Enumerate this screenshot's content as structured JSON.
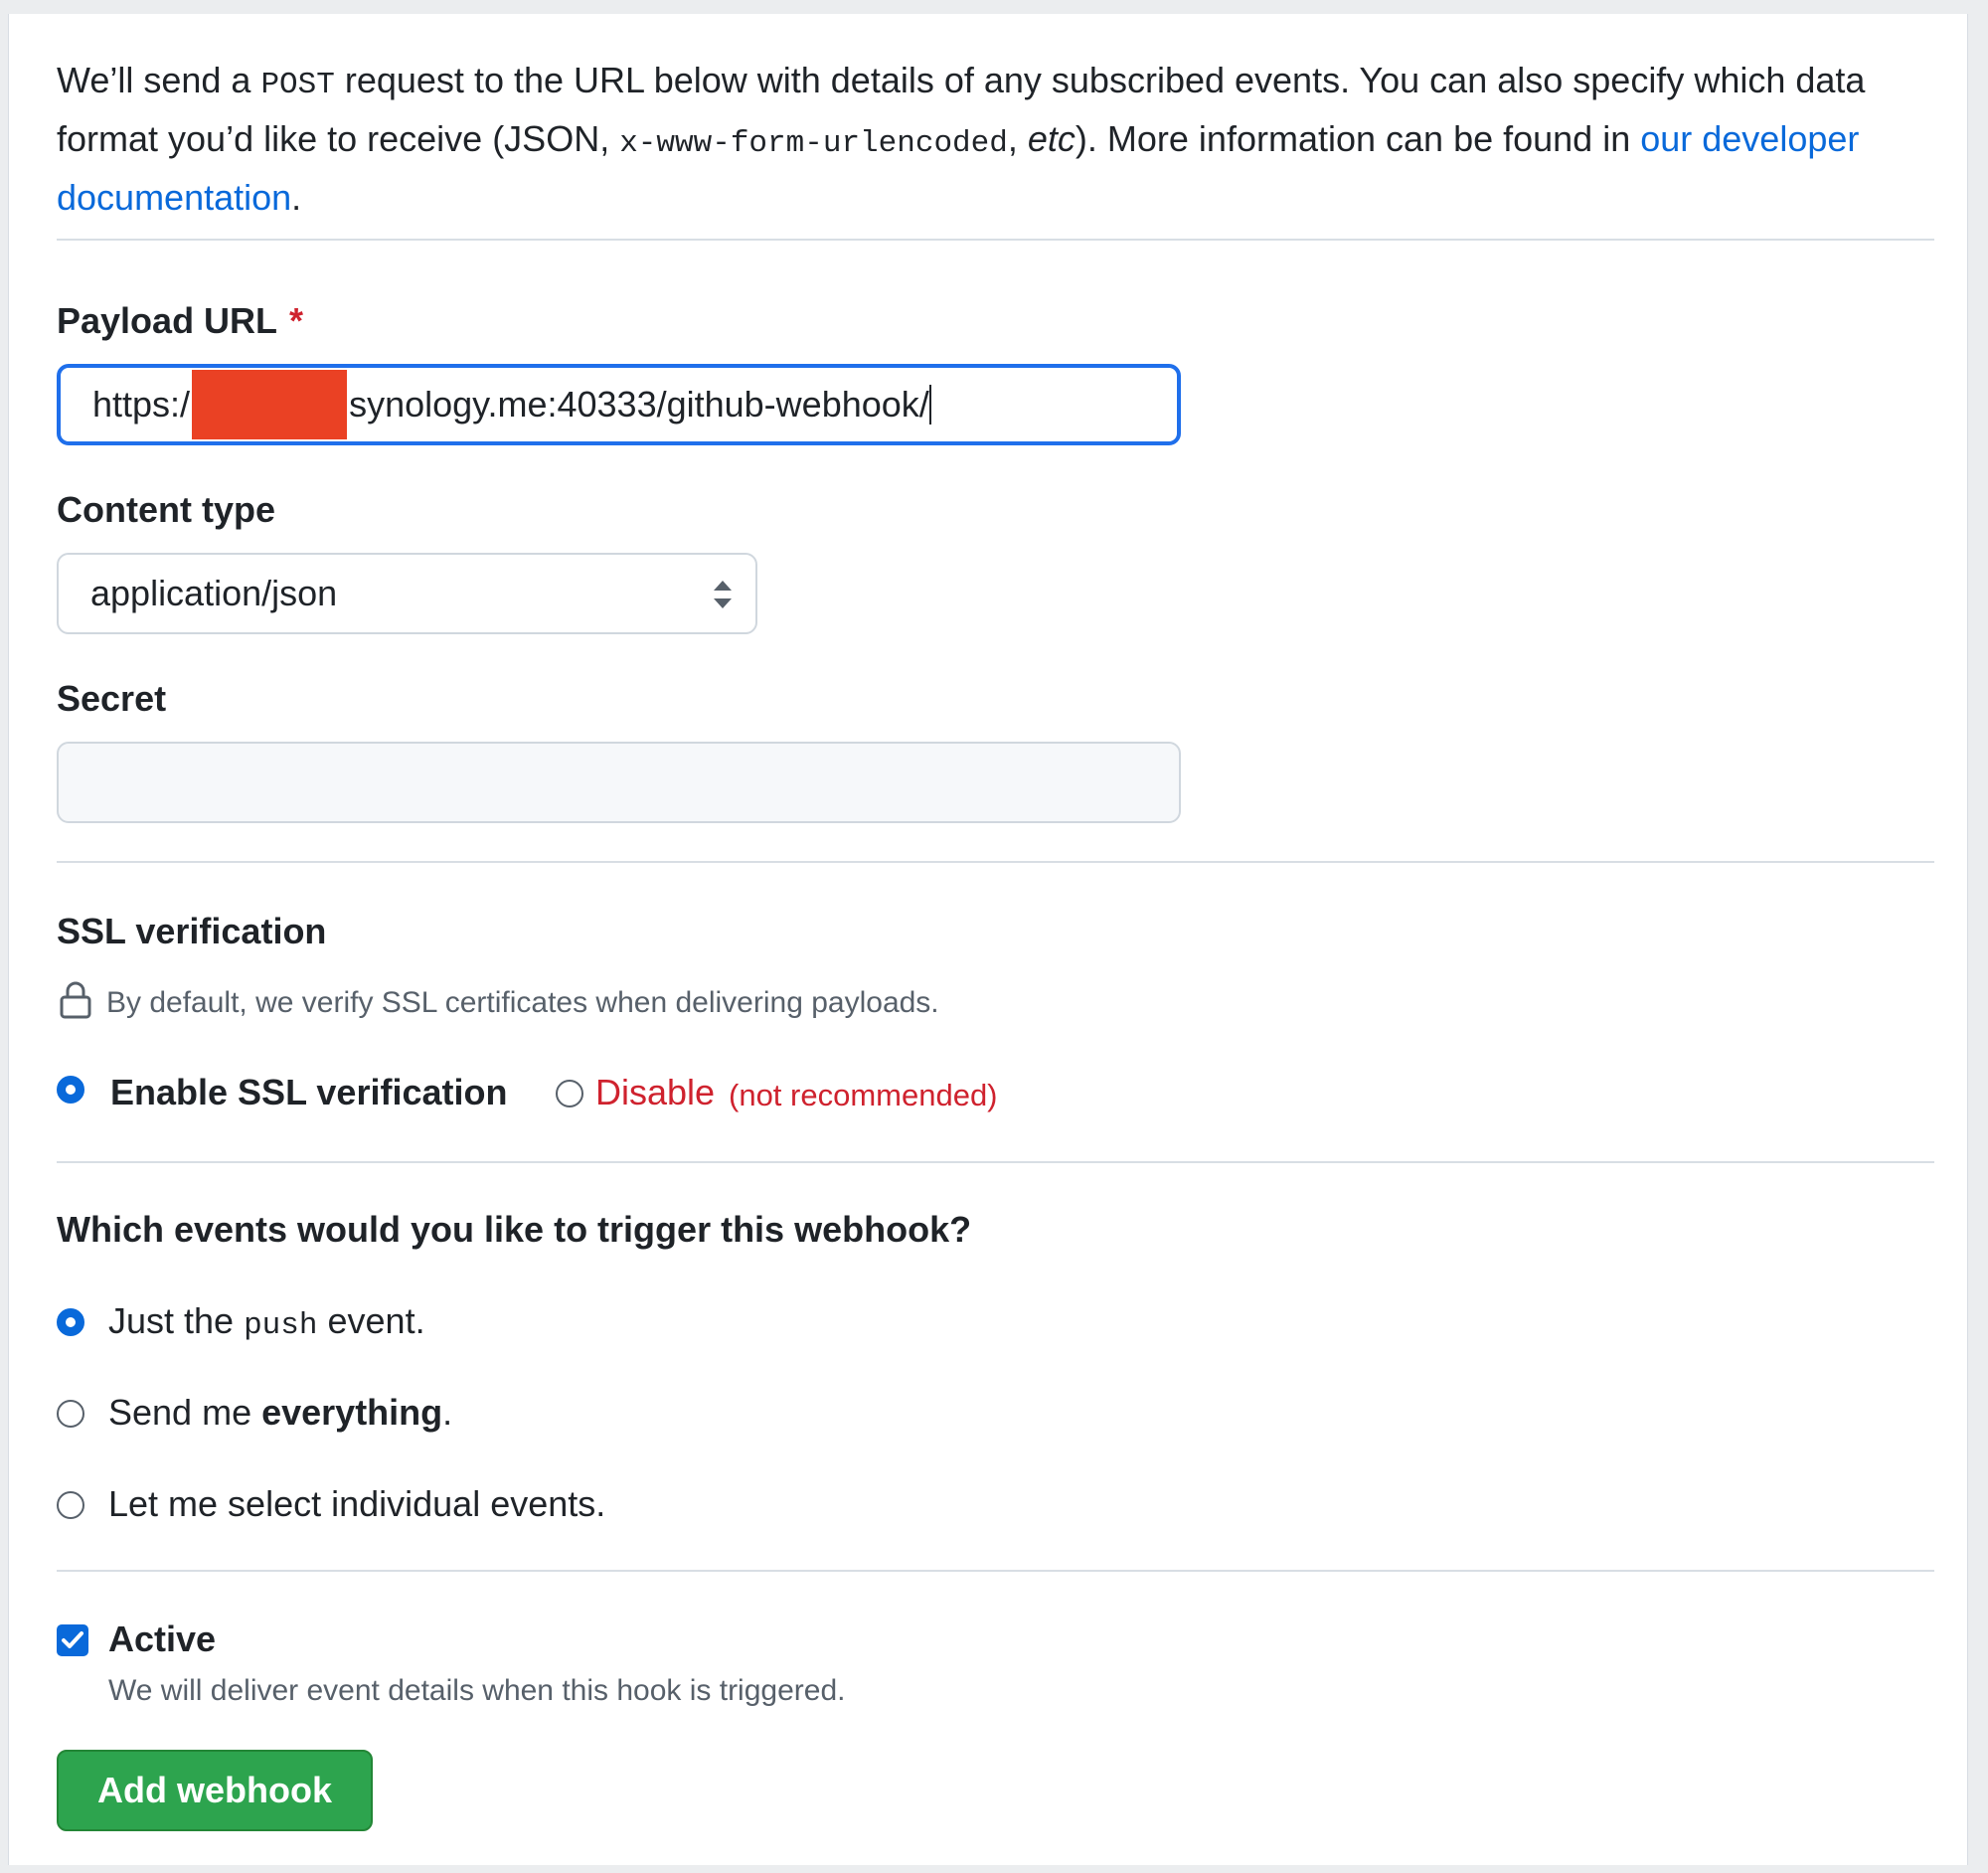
{
  "intro": {
    "p1": "We’ll send a ",
    "post_code": "POST",
    "p2": " request to the URL below with details of any subscribed events. You can also specify which data format you’d like to receive (JSON, ",
    "format_code": "x-www-form-urlencoded",
    "p3": ", ",
    "etc": "etc",
    "p4": "). More information can be found in ",
    "link_text": "our developer documentation",
    "p5": "."
  },
  "payload_url": {
    "label": "Payload URL",
    "required_mark": "*",
    "value_prefix": "https:/",
    "value_suffix": "synology.me:40333/github-webhook/"
  },
  "content_type": {
    "label": "Content type",
    "selected": "application/json"
  },
  "secret": {
    "label": "Secret",
    "value": ""
  },
  "ssl": {
    "heading": "SSL verification",
    "description": "By default, we verify SSL certificates when delivering payloads.",
    "enable_label": "Enable SSL verification",
    "disable_label": "Disable",
    "disable_note": "(not recommended)",
    "selected": "enable"
  },
  "events": {
    "heading": "Which events would you like to trigger this webhook?",
    "opt1_pre": "Just the ",
    "opt1_code": "push",
    "opt1_post": " event.",
    "opt2_pre": "Send me ",
    "opt2_bold": "everything",
    "opt2_post": ".",
    "opt3": "Let me select individual events.",
    "selected": "push"
  },
  "active": {
    "label": "Active",
    "checked": true,
    "description": "We will deliver event details when this hook is triggered."
  },
  "submit_label": "Add webhook",
  "colors": {
    "accent": "#0969da",
    "focus_border": "#1f6feb",
    "danger": "#cf222e",
    "button": "#2da44e",
    "redaction": "#ea4124"
  }
}
